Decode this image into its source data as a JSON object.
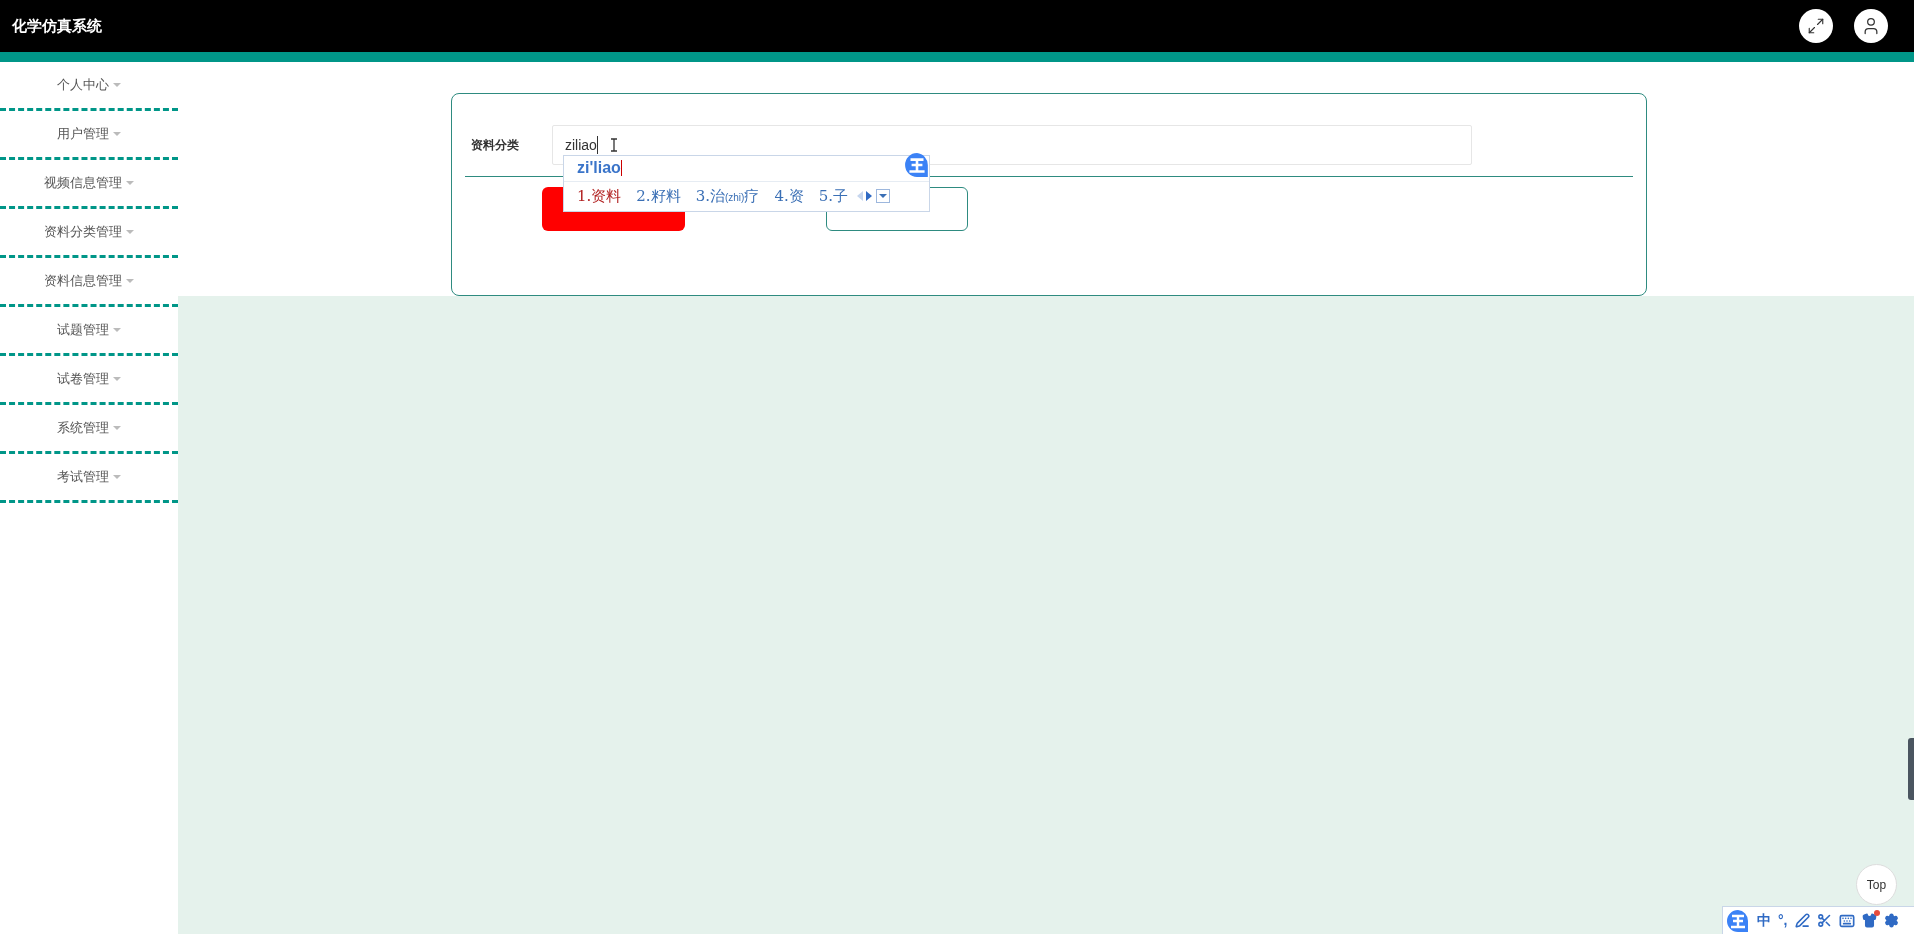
{
  "header": {
    "title": "化学仿真系统"
  },
  "sidebar": {
    "items": [
      {
        "label": "个人中心"
      },
      {
        "label": "用户管理"
      },
      {
        "label": "视频信息管理"
      },
      {
        "label": "资料分类管理"
      },
      {
        "label": "资料信息管理"
      },
      {
        "label": "试题管理"
      },
      {
        "label": "试卷管理"
      },
      {
        "label": "系统管理"
      },
      {
        "label": "考试管理"
      }
    ]
  },
  "form": {
    "label": "资料分类",
    "value": "ziliao"
  },
  "ime_popup": {
    "composition": "zi'liao",
    "candidates": [
      {
        "selected": true,
        "parts": [
          {
            "kind": "text",
            "text": "1.资料"
          }
        ]
      },
      {
        "selected": false,
        "parts": [
          {
            "kind": "text",
            "text": "2.籽料"
          }
        ]
      },
      {
        "selected": false,
        "parts": [
          {
            "kind": "text",
            "text": "3.治"
          },
          {
            "kind": "small",
            "text": "(zhi)"
          },
          {
            "kind": "text",
            "text": "疗"
          }
        ]
      },
      {
        "selected": false,
        "parts": [
          {
            "kind": "text",
            "text": "4.资"
          }
        ]
      },
      {
        "selected": false,
        "parts": [
          {
            "kind": "text",
            "text": "5.子"
          }
        ]
      }
    ]
  },
  "ime_toolbar": {
    "mode": "中",
    "punct": "°,"
  },
  "top_button": {
    "label": "Top"
  }
}
